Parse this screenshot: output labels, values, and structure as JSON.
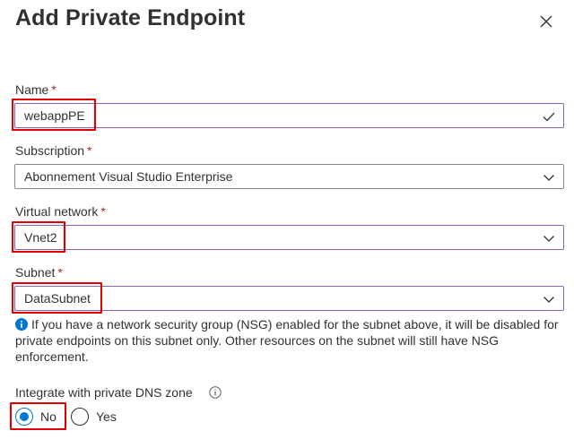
{
  "panel": {
    "title": "Add Private Endpoint",
    "close_icon": "close-icon"
  },
  "fields": {
    "name": {
      "label": "Name",
      "required": "*",
      "value": "webappPE"
    },
    "subscription": {
      "label": "Subscription",
      "required": "*",
      "value": "Abonnement Visual Studio Enterprise"
    },
    "virtual_network": {
      "label": "Virtual network",
      "required": "*",
      "value": "Vnet2"
    },
    "subnet": {
      "label": "Subnet",
      "required": "*",
      "value": "DataSubnet"
    }
  },
  "info_message": "If you have a network security group (NSG) enabled for the subnet above, it will be disabled for private endpoints on this subnet only. Other resources on the subnet will still have NSG enforcement.",
  "dns": {
    "label": "Integrate with private DNS zone",
    "options": [
      {
        "label": "No",
        "selected": true
      },
      {
        "label": "Yes",
        "selected": false
      }
    ]
  },
  "colors": {
    "accent": "#0078d4",
    "focus_border": "#8764b8",
    "highlight": "#e00000",
    "required": "#a4262c"
  }
}
